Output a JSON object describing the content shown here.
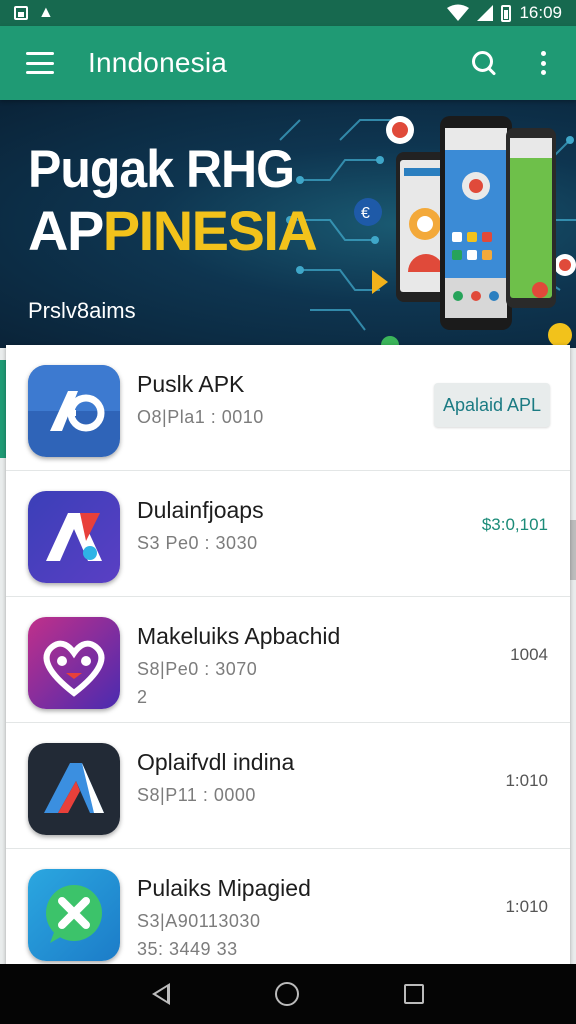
{
  "status_bar": {
    "time": "16:09"
  },
  "app_bar": {
    "title": "Inndonesia"
  },
  "banner": {
    "title_line1": "Pugak RHG",
    "title_line2_prefix": "AP",
    "title_line2_accent": "PINESIA",
    "subtitle": "Prslv8aims",
    "accent_color": "#f2c21b"
  },
  "apps": [
    {
      "name": "Puslk APK",
      "meta": "O8|Pla1 : 0010",
      "meta2": "",
      "action": "Apalaid APL",
      "action_style": "button"
    },
    {
      "name": "Dulainfjoaps",
      "meta": "S3  Pe0 : 3030",
      "meta2": "",
      "action": "$3:0,101",
      "action_style": "accent"
    },
    {
      "name": "Makeluiks Apbachid",
      "meta": "S8|Pe0 : 3070",
      "meta2": "2",
      "action": "1004",
      "action_style": "text"
    },
    {
      "name": "Oplaifvdl indina",
      "meta": "S8|P11 : 0000",
      "meta2": "",
      "action": "1:010",
      "action_style": "text"
    },
    {
      "name": "Pulaiks Mipagied",
      "meta": "S3|A90113030",
      "meta2": "35: 3449 33",
      "action": "1:010",
      "action_style": "text"
    }
  ],
  "colors": {
    "app_bar": "#1f9a74",
    "status_bar": "#17694f"
  }
}
